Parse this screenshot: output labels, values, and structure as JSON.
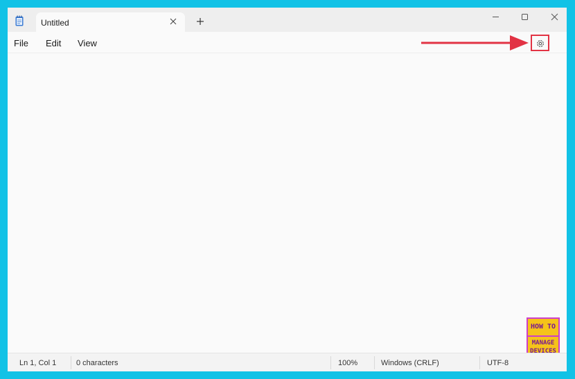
{
  "tab": {
    "title": "Untitled"
  },
  "menu": {
    "file": "File",
    "edit": "Edit",
    "view": "View"
  },
  "status": {
    "position": "Ln 1, Col 1",
    "characters": "0 characters",
    "zoom": "100%",
    "line_ending": "Windows (CRLF)",
    "encoding": "UTF-8"
  },
  "logo": {
    "line1": "HOW TO",
    "line2": "MANAGE",
    "line3": "DEVICES"
  },
  "icons": {
    "app": "notepad-icon",
    "tab_close": "close-icon",
    "new_tab": "plus-icon",
    "minimize": "minimize-icon",
    "maximize": "maximize-icon",
    "close": "close-icon",
    "settings": "gear-icon",
    "annotation": "arrow-right-icon"
  },
  "colors": {
    "background": "#12c2e6",
    "highlight": "#e23344",
    "logo_purple": "#cc3fc9",
    "logo_yellow": "#f5c31a"
  }
}
